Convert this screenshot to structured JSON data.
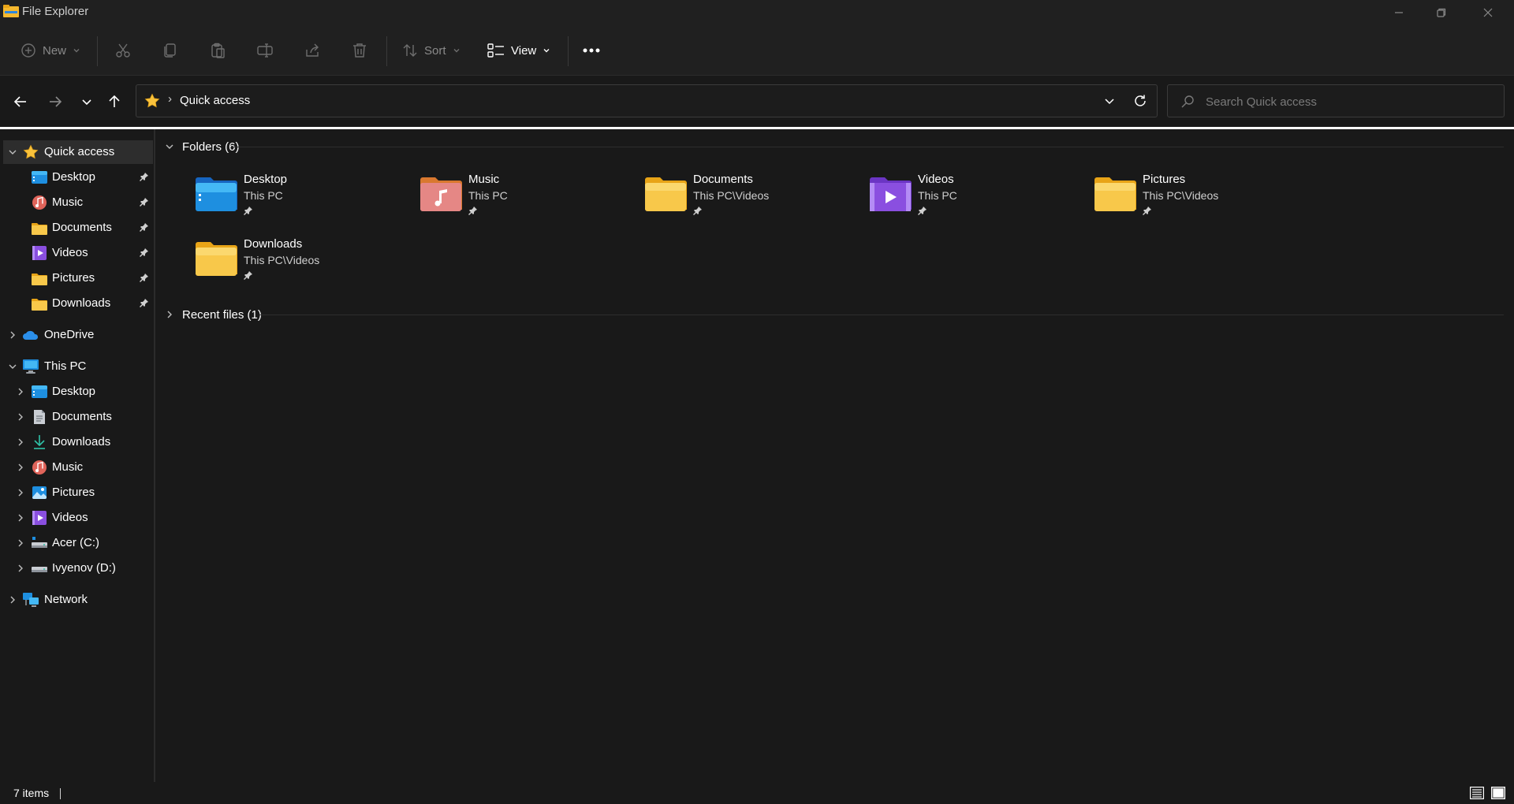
{
  "window": {
    "title": "File Explorer"
  },
  "commandbar": {
    "new_label": "New",
    "sort_label": "Sort",
    "view_label": "View"
  },
  "address": {
    "crumb": "Quick access",
    "search_placeholder": "Search Quick access"
  },
  "sidebar": {
    "quick_access": {
      "label": "Quick access",
      "items": [
        {
          "label": "Desktop",
          "icon": "desktop-icon"
        },
        {
          "label": "Music",
          "icon": "music-icon"
        },
        {
          "label": "Documents",
          "icon": "folder-icon"
        },
        {
          "label": "Videos",
          "icon": "videos-icon"
        },
        {
          "label": "Pictures",
          "icon": "folder-icon"
        },
        {
          "label": "Downloads",
          "icon": "folder-icon"
        }
      ]
    },
    "onedrive": {
      "label": "OneDrive"
    },
    "this_pc": {
      "label": "This PC",
      "items": [
        {
          "label": "Desktop",
          "icon": "desktop-icon"
        },
        {
          "label": "Documents",
          "icon": "documents-icon"
        },
        {
          "label": "Downloads",
          "icon": "downloads-icon"
        },
        {
          "label": "Music",
          "icon": "music-icon"
        },
        {
          "label": "Pictures",
          "icon": "pictures-icon"
        },
        {
          "label": "Videos",
          "icon": "videos-icon"
        },
        {
          "label": "Acer (C:)",
          "icon": "drive-icon"
        },
        {
          "label": "Ivyenov (D:)",
          "icon": "drive-icon"
        }
      ]
    },
    "network": {
      "label": "Network"
    }
  },
  "content": {
    "folders_header": "Folders (6)",
    "recent_header": "Recent files (1)",
    "folders": [
      {
        "name": "Desktop",
        "path": "This PC",
        "icon": "desktop-folder-icon"
      },
      {
        "name": "Music",
        "path": "This PC",
        "icon": "music-folder-icon"
      },
      {
        "name": "Documents",
        "path": "This PC\\Videos",
        "icon": "folder-icon"
      },
      {
        "name": "Videos",
        "path": "This PC",
        "icon": "videos-folder-icon"
      },
      {
        "name": "Pictures",
        "path": "This PC\\Videos",
        "icon": "folder-icon"
      },
      {
        "name": "Downloads",
        "path": "This PC\\Videos",
        "icon": "folder-icon"
      }
    ]
  },
  "status": {
    "count": "7 items"
  },
  "colors": {
    "background": "#191919",
    "chrome": "#202020",
    "folder_yellow": "#F8C84A",
    "accent_blue": "#1E8FE0"
  }
}
